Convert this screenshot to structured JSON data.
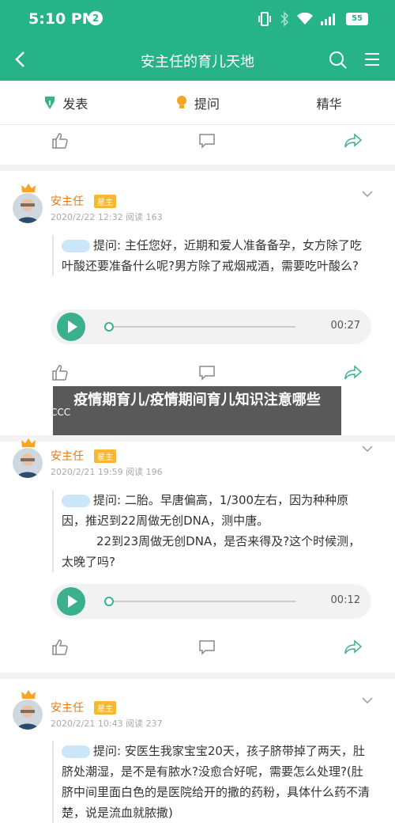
{
  "status_bar": {
    "time": "5:10 PM",
    "notification_count": "2",
    "battery": "55"
  },
  "app_bar": {
    "title": "安主任的育儿天地"
  },
  "tabs": [
    {
      "label": "发表"
    },
    {
      "label": "提问"
    },
    {
      "label": "精华"
    }
  ],
  "overlay": {
    "title": "疫情期育儿/疫情期间育儿知识注意哪些"
  },
  "posts": [
    {
      "author": "安主任",
      "badge": "星主",
      "meta": "2020/2/22 12:32  阅读 163",
      "question_prefix": "提问:",
      "question": "主任您好，近期和爱人准备备孕，女方除了吃叶酸还要准备什么呢?男方除了戒烟戒酒，需要吃叶酸么?",
      "audio_duration": "00:27"
    },
    {
      "author": "安主任",
      "badge": "星主",
      "meta": "2020/2/21 19:59  阅读 196",
      "question_prefix": "提问:",
      "question": "二胎。早唐偏高，1/300左右，因为种种原因，推迟到22周做无创DNA，测中唐。",
      "question_cont": "22到23周做无创DNA，是否来得及?这个时候测，太晚了吗?",
      "audio_duration": "00:12"
    },
    {
      "author": "安主任",
      "badge": "星主",
      "meta": "2020/2/21 10:43  阅读 237",
      "question_prefix": "提问:",
      "question": "安医生我家宝宝20天，孩子脐带掉了两天，肚脐处潮湿，是不是有脓水?没愈合好呢，需要怎么处理?(肚脐中间里面白色的是医院给开的撒的药粉，具体什么药不清楚，说是流血就脓撒)"
    }
  ],
  "liker": "CCC",
  "colors": {
    "primary": "#26b388",
    "author": "#e07b1c",
    "badge": "#f7b731"
  }
}
